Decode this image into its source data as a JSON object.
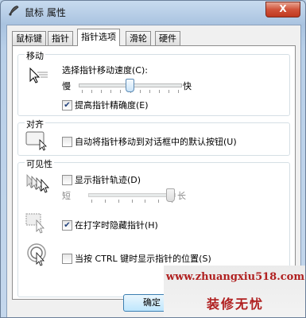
{
  "window": {
    "title": "鼠标 属性",
    "close_glyph": "X"
  },
  "tabs": [
    {
      "label": "鼠标键"
    },
    {
      "label": "指针"
    },
    {
      "label": "指针选项",
      "active": true
    },
    {
      "label": "滑轮"
    },
    {
      "label": "硬件"
    }
  ],
  "motion": {
    "title": "移动",
    "speed_label": "选择指针移动速度(C):",
    "slow_label": "慢",
    "fast_label": "快",
    "speed_level": 0.5,
    "precision_label": "提高指针精确度(E)",
    "precision_checked": true
  },
  "snap": {
    "title": "对齐",
    "snap_label": "自动将指针移动到对话框中的默认按钮(U)",
    "snap_checked": false
  },
  "visibility": {
    "title": "可见性",
    "trails_label": "显示指针轨迹(D)",
    "trails_checked": false,
    "short_label": "短",
    "long_label": "长",
    "trails_level": 1.0,
    "hide_label": "在打字时隐藏指针(H)",
    "hide_checked": true,
    "ctrl_label": "当按 CTRL 键时显示指针的位置(S)",
    "ctrl_checked": false
  },
  "buttons": {
    "ok_label": "确定"
  },
  "watermark": {
    "url": "www.zhuangxiu518.com",
    "brand": "装修无忧"
  },
  "check_glyph": "✔"
}
